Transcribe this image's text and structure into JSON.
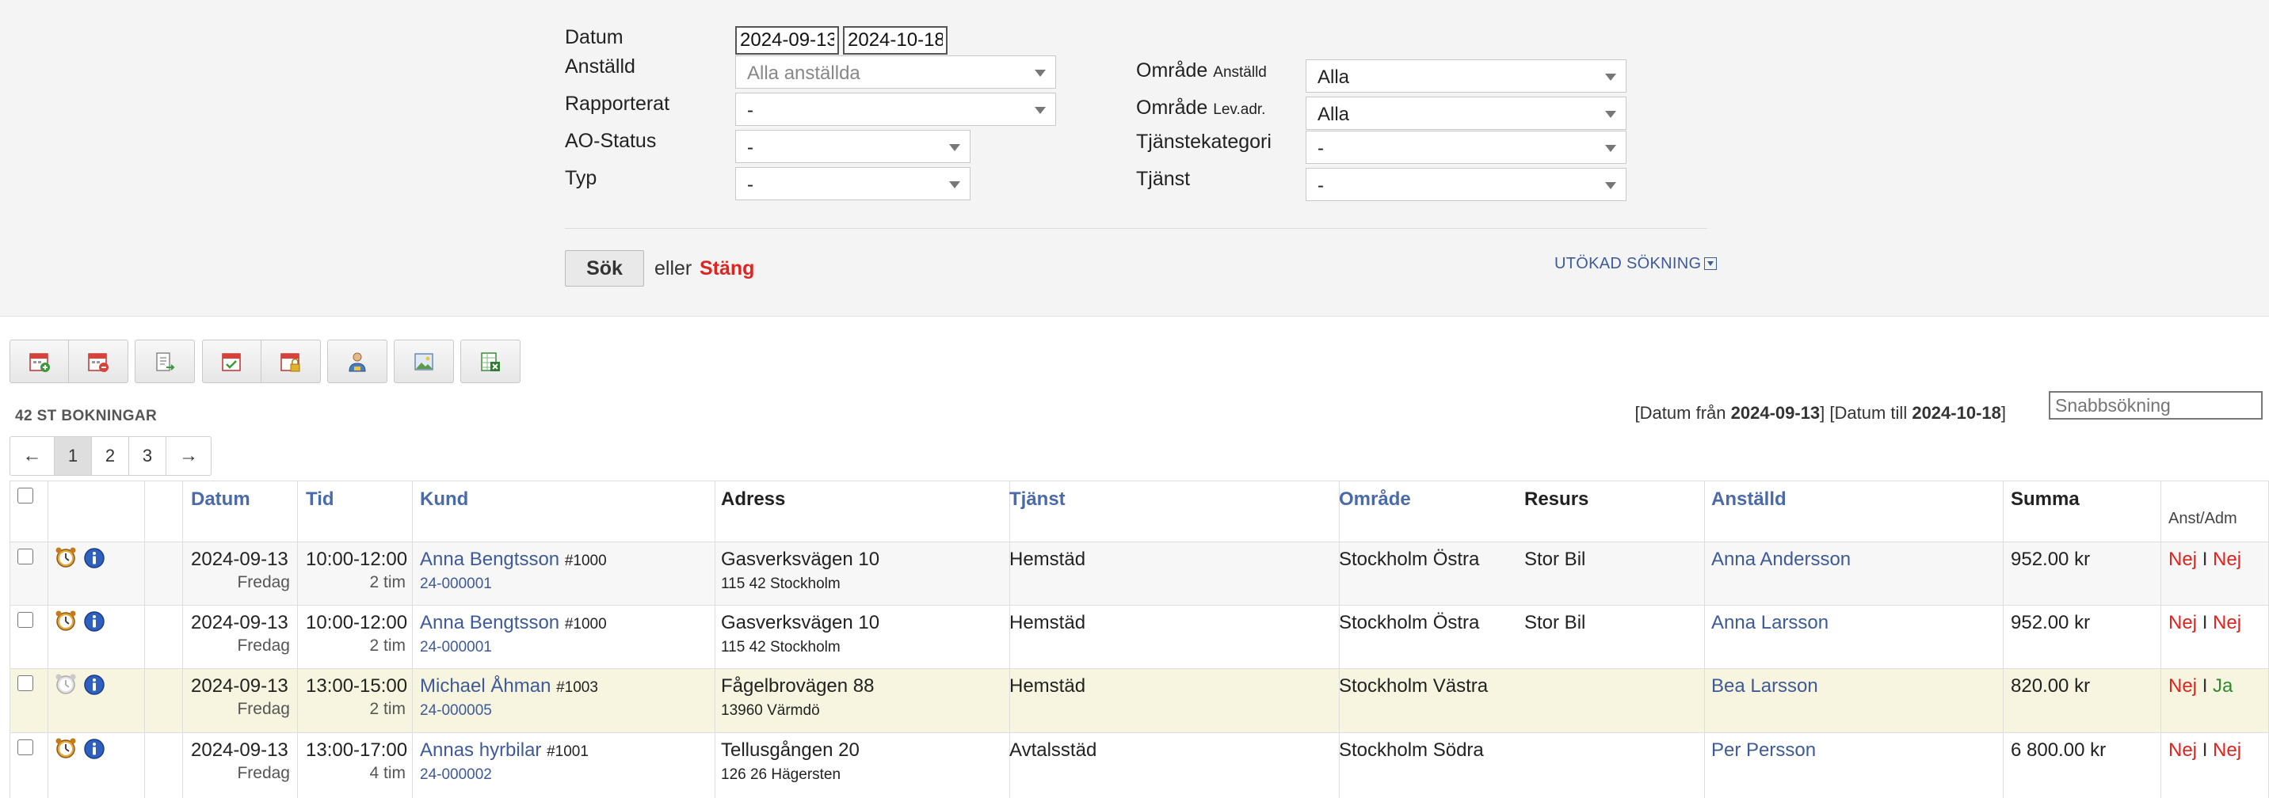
{
  "filters": {
    "date_label": "Datum",
    "date_from": "2024-09-13",
    "date_to": "2024-10-18",
    "employee_label": "Anställd",
    "employee_placeholder": "Alla anställda",
    "reported_label": "Rapporterat",
    "reported_value": "-",
    "ao_status_label": "AO-Status",
    "ao_status_value": "-",
    "type_label": "Typ",
    "type_value": "-",
    "area_emp_label": "Område",
    "area_emp_sub": "Anställd",
    "area_emp_value": "Alla",
    "area_addr_label": "Område",
    "area_addr_sub": "Lev.adr.",
    "area_addr_value": "Alla",
    "service_cat_label": "Tjänstekategori",
    "service_cat_value": "-",
    "service_label": "Tjänst",
    "service_value": "-",
    "search_button": "Sök",
    "or_text": "eller",
    "close_link": "Stäng",
    "extended_search": "UTÖKAD SÖKNING"
  },
  "toolbar": {
    "icons": [
      "calendar-add-icon",
      "calendar-remove-icon",
      "document-export-icon",
      "calendar-check-icon",
      "calendar-lock-icon",
      "user-assign-icon",
      "image-icon",
      "spreadsheet-export-icon"
    ]
  },
  "summary": {
    "count_label": "42 ST BOKNINGAR",
    "range_from_label": "Datum från",
    "range_from": "2024-09-13",
    "range_to_label": "Datum till",
    "range_to": "2024-10-18",
    "quick_search_placeholder": "Snabbsökning"
  },
  "pagination": {
    "prev": "←",
    "pages": [
      "1",
      "2",
      "3"
    ],
    "active_page": "1",
    "next": "→"
  },
  "table": {
    "columns": [
      "Datum",
      "Tid",
      "Kund",
      "Adress",
      "Tjänst",
      "Område",
      "Resurs",
      "Anställd",
      "Summa",
      "Anst/Adm"
    ],
    "rows": [
      {
        "date": "2024-09-13",
        "weekday": "Fredag",
        "time": "10:00-12:00",
        "duration": "2 tim",
        "customer": "Anna Bengtsson",
        "customer_no": "#1000",
        "order_no": "24-000001",
        "street": "Gasverksvägen 10",
        "city": "115 42 Stockholm",
        "service": "Hemstäd",
        "area": "Stockholm Östra",
        "resource": "Stor Bil",
        "employee": "Anna Andersson",
        "sum": "952.00 kr",
        "anst": "Nej",
        "adm": "Nej",
        "separator": "I",
        "alarm_active": true
      },
      {
        "date": "2024-09-13",
        "weekday": "Fredag",
        "time": "10:00-12:00",
        "duration": "2 tim",
        "customer": "Anna Bengtsson",
        "customer_no": "#1000",
        "order_no": "24-000001",
        "street": "Gasverksvägen 10",
        "city": "115 42 Stockholm",
        "service": "Hemstäd",
        "area": "Stockholm Östra",
        "resource": "Stor Bil",
        "employee": "Anna Larsson",
        "sum": "952.00 kr",
        "anst": "Nej",
        "adm": "Nej",
        "separator": "I",
        "alarm_active": true
      },
      {
        "date": "2024-09-13",
        "weekday": "Fredag",
        "time": "13:00-15:00",
        "duration": "2 tim",
        "customer": "Michael Åhman",
        "customer_no": "#1003",
        "order_no": "24-000005",
        "street": "Fågelbrovägen 88",
        "city": "13960 Värmdö",
        "service": "Hemstäd",
        "area": "Stockholm Västra",
        "resource": "",
        "employee": "Bea Larsson",
        "sum": "820.00 kr",
        "anst": "Nej",
        "adm": "Ja",
        "separator": "I",
        "alarm_active": false
      },
      {
        "date": "2024-09-13",
        "weekday": "Fredag",
        "time": "13:00-17:00",
        "duration": "4 tim",
        "customer": "Annas hyrbilar",
        "customer_no": "#1001",
        "order_no": "24-000002",
        "street": "Tellusgången 20",
        "city": "126 26 Hägersten",
        "service": "Avtalsstäd",
        "area": "Stockholm Södra",
        "resource": "",
        "employee": "Per Persson",
        "sum": "6 800.00 kr",
        "anst": "Nej",
        "adm": "Nej",
        "separator": "I",
        "alarm_active": true
      }
    ]
  },
  "colors": {
    "link": "#3d5a99",
    "header_link": "#4a6aa8",
    "negative": "#e0231e",
    "positive": "#2d8a2d",
    "highlight_row": "#f7f4df",
    "panel_bg": "#f4f4f4"
  }
}
